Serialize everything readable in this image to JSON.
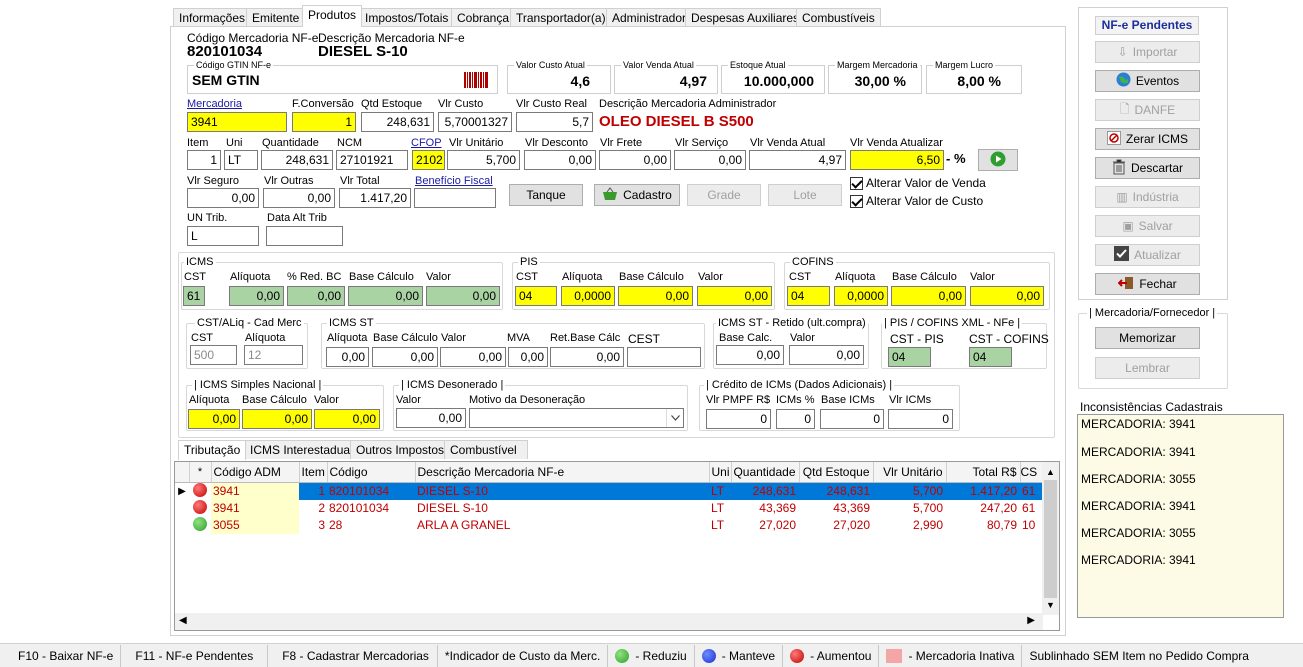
{
  "tabs": [
    "Informações",
    "Emitente",
    "Produtos",
    "Impostos/Totais",
    "Cobrança",
    "Transportador(a)",
    "Administrador",
    "Despesas Auxiliares",
    "Combustíveis"
  ],
  "header": {
    "codigo_label": "Código Mercadoria NF-e",
    "codigo": "820101034",
    "descricao_label": "Descrição Mercadoria NF-e",
    "descricao": "DIESEL S-10",
    "gtin_label": "Código GTIN NF-e",
    "gtin": "SEM GTIN",
    "custo_atual_label": "Valor Custo Atual",
    "custo_atual": "4,6",
    "venda_atual_label": "Valor Venda Atual",
    "venda_atual": "4,97",
    "estoque_label": "Estoque Atual",
    "estoque": "10.000,000",
    "margem_merc_label": "Margem Mercadoria",
    "margem_merc": "30,00 %",
    "margem_lucro_label": "Margem Lucro",
    "margem_lucro": "8,00 %"
  },
  "row1": {
    "mercadoria_label": "Mercadoria",
    "mercadoria": "3941",
    "fconv_label": "F.Conversão",
    "fconv": "1",
    "qtd_est_label": "Qtd Estoque",
    "qtd_est": "248,631",
    "vlr_custo_label": "Vlr Custo",
    "vlr_custo": "5,70001327",
    "vlr_custo_real_label": "Vlr Custo Real",
    "vlr_custo_real": "5,7",
    "desc_adm_label": "Descrição Mercadoria Administrador",
    "desc_adm": "OLEO DIESEL B S500"
  },
  "row2": {
    "item_label": "Item",
    "item": "1",
    "uni_label": "Uni",
    "uni": "LT",
    "qtd_label": "Quantidade",
    "qtd": "248,631",
    "ncm_label": "NCM",
    "ncm": "27101921",
    "cfop_label": "CFOP",
    "cfop": "2102",
    "vunit_label": "Vlr Unitário",
    "vunit": "5,700",
    "vdesc_label": "Vlr Desconto",
    "vdesc": "0,00",
    "vfrete_label": "Vlr Frete",
    "vfrete": "0,00",
    "vserv_label": "Vlr Serviço",
    "vserv": "0,00",
    "vvenda_label": "Vlr Venda Atual",
    "vvenda": "4,97",
    "vatual_label": "Vlr Venda Atualizar",
    "vatual": "6,50",
    "pct": "- %"
  },
  "row3": {
    "vseg_label": "Vlr Seguro",
    "vseg": "0,00",
    "vout_label": "Vlr Outras",
    "vout": "0,00",
    "vtot_label": "Vlr Total",
    "vtot": "1.417,20",
    "benef_label": "Benefício Fiscal",
    "benef": "",
    "tanque": "Tanque",
    "cadastro": "Cadastro",
    "grade": "Grade",
    "lote": "Lote",
    "alt_venda": "Alterar Valor de Venda",
    "alt_custo": "Alterar Valor de Custo"
  },
  "row4": {
    "untrib_label": "UN Trib.",
    "untrib": "L",
    "dtalt_label": "Data Alt Trib",
    "dtalt": ""
  },
  "icms": {
    "title": "ICMS",
    "cst_label": "CST",
    "aliq_label": "Alíquota",
    "red_label": "% Red. BC",
    "base_label": "Base Cálculo",
    "valor_label": "Valor",
    "cst": "61",
    "aliq": "0,00",
    "red": "0,00",
    "base": "0,00",
    "valor": "0,00"
  },
  "pis": {
    "title": "PIS",
    "cst_label": "CST",
    "aliq_label": "Alíquota",
    "base_label": "Base Cálculo",
    "valor_label": "Valor",
    "cst": "04",
    "aliq": "0,0000",
    "base": "0,00",
    "valor": "0,00"
  },
  "cofins": {
    "title": "COFINS",
    "cst_label": "CST",
    "aliq_label": "Alíquota",
    "base_label": "Base Cálculo",
    "valor_label": "Valor",
    "cst": "04",
    "aliq": "0,0000",
    "base": "0,00",
    "valor": "0,00"
  },
  "cstaliq": {
    "title": "CST/ALiq - Cad Merc",
    "cst_label": "CST",
    "aliq_label": "Alíquota",
    "cst": "500",
    "aliq": "12"
  },
  "icmsst": {
    "title": "ICMS ST",
    "aliq_label": "Alíquota",
    "base_label": "Base Cálculo",
    "valor_label": "Valor",
    "mva_label": "MVA",
    "ret_label": "Ret.Base Cálc",
    "cest_label": "CEST",
    "aliq": "0,00",
    "base": "0,00",
    "valor": "0,00",
    "mva": "0,00",
    "ret": "0,00",
    "cest": ""
  },
  "stret": {
    "title": "ICMS ST - Retido (ult.compra)",
    "base_label": "Base Calc.",
    "valor_label": "Valor",
    "base": "0,00",
    "valor": "0,00"
  },
  "piscofxml": {
    "title": "| PIS / COFINS XML - NFe |",
    "pis_label": "CST - PIS",
    "cof_label": "CST - COFINS",
    "pis": "04",
    "cof": "04"
  },
  "simples": {
    "title": "| ICMS Simples Nacional |",
    "aliq_label": "Alíquota",
    "base_label": "Base Cálculo",
    "valor_label": "Valor",
    "aliq": "0,00",
    "base": "0,00",
    "valor": "0,00"
  },
  "deson": {
    "title": "| ICMS Desonerado |",
    "valor_label": "Valor",
    "motivo_label": "Motivo da Desoneração",
    "valor": "0,00",
    "motivo": ""
  },
  "credito": {
    "title": "| Crédito de ICMs (Dados Adicionais) |",
    "pmpf_label": "Vlr PMPF R$",
    "pct_label": "ICMs %",
    "base_label": "Base ICMs",
    "vicms_label": "Vlr ICMs",
    "pmpf": "0",
    "pct": "0",
    "base": "0",
    "vicms": "0"
  },
  "subtabs": [
    "Tributação",
    "ICMS Interestadual",
    "Outros Impostos",
    "Combustível"
  ],
  "grid": {
    "cols": [
      "*",
      "Código ADM",
      "Item",
      "Código",
      "Descrição Mercadoria NF-e",
      "Uni",
      "Quantidade",
      "Qtd Estoque",
      "Vlr Unitário",
      "Total R$",
      "CS"
    ],
    "rows": [
      [
        "3941",
        "1",
        "820101034",
        "DIESEL S-10",
        "LT",
        "248,631",
        "248,631",
        "5,700",
        "1.417,20",
        "61"
      ],
      [
        "3941",
        "2",
        "820101034",
        "DIESEL S-10",
        "LT",
        "43,369",
        "43,369",
        "5,700",
        "247,20",
        "61"
      ],
      [
        "3055",
        "3",
        "28",
        "ARLA A GRANEL",
        "LT",
        "27,020",
        "27,020",
        "2,990",
        "80,79",
        "10"
      ]
    ]
  },
  "side": {
    "title": "NF-e Pendentes",
    "importar": "Importar",
    "eventos": "Eventos",
    "danfe": "DANFE",
    "zerar": "Zerar ICMS",
    "descartar": "Descartar",
    "industria": "Indústria",
    "salvar": "Salvar",
    "atualizar": "Atualizar",
    "fechar": "Fechar",
    "merc_forn_title": "| Mercadoria/Fornecedor |",
    "memorizar": "Memorizar",
    "lembrar": "Lembrar",
    "incons_title": "Inconsistências Cadastrais",
    "incons": [
      "MERCADORIA: 3941",
      "MERCADORIA: 3941",
      "MERCADORIA: 3055",
      "MERCADORIA: 3941",
      "MERCADORIA: 3055",
      "MERCADORIA: 3941"
    ]
  },
  "status": {
    "f10": "F10 - Baixar NF-e",
    "f11": "F11 - NF-e Pendentes",
    "f8": "F8 - Cadastrar Mercadorias",
    "ind": "*Indicador de Custo da Merc.",
    "reduziu": "- Reduziu",
    "manteve": "- Manteve",
    "aumentou": "- Aumentou",
    "inativa": "- Mercadoria Inativa",
    "sublinhado": "Sublinhado SEM Item no Pedido Compra"
  },
  "colors": {
    "yellow": "#ffff00",
    "green": "#a9d3a3",
    "selected": "#0078d7",
    "red_text": "#c00000",
    "panel_title": "#1c2e9c"
  }
}
